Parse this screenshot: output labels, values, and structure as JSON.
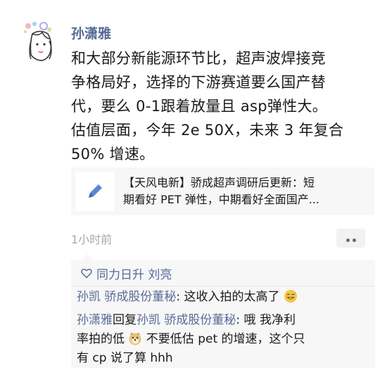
{
  "post": {
    "author": "孙潇雅",
    "lines": [
      "和大部分新能源环节比，超声波焊接竞",
      "争格局好，选择的下游赛道要么国产替",
      "代，要么 0-1跟着放量且 asp弹性大。",
      "估值层面，今年 2e 50X，未来 3 年复合",
      "50% 增速。"
    ],
    "link": {
      "line1": "【天风电新】骄成超声调研后更新：短",
      "line2": "期看好 PET 弹性，中期看好全面国产..."
    },
    "time": "1小时前",
    "icons": {
      "avatar": "sketch-avatar-icon",
      "link": "pencil-icon",
      "more": "more-dots-icon",
      "like": "heart-outline-icon"
    }
  },
  "comments": {
    "likes": "同力日升 刘亮",
    "items": [
      {
        "name": "孙凯 骄成股份董秘",
        "sep": ": ",
        "text": "这收入拍的太高了"
      },
      {
        "name": "孙潇雅",
        "reply_word": "回复",
        "reply_to": "孙凯 骄成股份董秘",
        "sep": ": ",
        "text1": "哦 我净利",
        "text2": "率拍的低",
        "text3": " 不要低估 pet 的增速，这个只",
        "text4": "有 cp 说了算 hhh"
      }
    ]
  },
  "colors": {
    "name": "#576b95",
    "time": "#a8a8a8",
    "panel": "#f7f7f7"
  }
}
